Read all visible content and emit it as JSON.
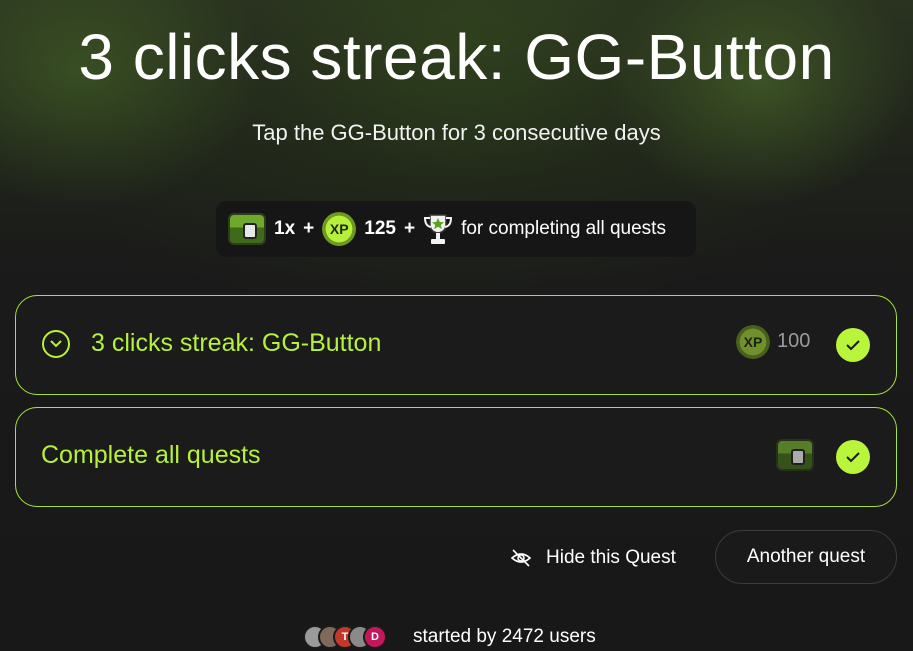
{
  "header": {
    "title": "3 clicks streak: GG-Button",
    "subtitle": "Tap the GG-Button for 3 consecutive days"
  },
  "reward_bar": {
    "chest_count": "1x",
    "plus1": "+",
    "xp_badge": "XP",
    "xp_amount": "125",
    "plus2": "+",
    "text": "for completing all quests",
    "icons": [
      "treasure-chest-icon",
      "xp-coin-icon",
      "trophy-icon"
    ]
  },
  "quests": [
    {
      "title": "3 clicks streak: GG-Button",
      "xp_badge": "XP",
      "xp": "100",
      "completed": true
    },
    {
      "title": "Complete all quests",
      "completed": true
    }
  ],
  "actions": {
    "hide_label": "Hide this Quest",
    "another_label": "Another quest"
  },
  "footer": {
    "started_text": "started by 2472 users",
    "avatars": [
      {
        "initial": "",
        "color": "#9a9a9a"
      },
      {
        "initial": "",
        "color": "#7d6a5a"
      },
      {
        "initial": "T",
        "color": "#c0392b"
      },
      {
        "initial": "",
        "color": "#8a8a8a"
      },
      {
        "initial": "D",
        "color": "#c2185b"
      }
    ]
  },
  "colors": {
    "accent": "#b6f23a",
    "card_border": "#a6e33a",
    "background": "#181818"
  }
}
